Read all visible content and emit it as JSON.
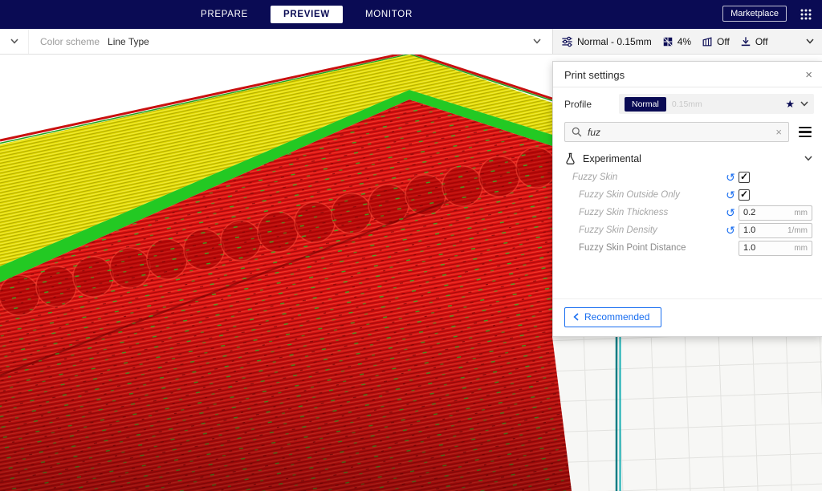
{
  "topbar": {
    "tabs": [
      {
        "label": "PREPARE",
        "active": false
      },
      {
        "label": "PREVIEW",
        "active": true
      },
      {
        "label": "MONITOR",
        "active": false
      }
    ],
    "marketplace_label": "Marketplace"
  },
  "stage_toolbar": {
    "color_scheme_label": "Color scheme",
    "color_scheme_value": "Line Type",
    "printer_config": {
      "profile": "Normal - 0.15mm",
      "infill_percent": "4%",
      "support": "Off",
      "adhesion": "Off"
    }
  },
  "print_settings": {
    "title": "Print settings",
    "close_glyph": "×",
    "profile_label": "Profile",
    "profile_name": "Normal",
    "profile_detail": "0.15mm",
    "star_glyph": "★",
    "search_value": "fuz",
    "clear_glyph": "×",
    "reset_glyph": "↺",
    "section_label": "Experimental",
    "settings": [
      {
        "label": "Fuzzy Skin",
        "type": "checkbox",
        "checked": true,
        "reset": true
      },
      {
        "label": "Fuzzy Skin Outside Only",
        "type": "checkbox",
        "checked": true,
        "reset": true
      },
      {
        "label": "Fuzzy Skin Thickness",
        "type": "number",
        "value": "0.2",
        "unit": "mm",
        "reset": true
      },
      {
        "label": "Fuzzy Skin Density",
        "type": "number",
        "value": "1.0",
        "unit": "1/mm",
        "reset": true
      },
      {
        "label": "Fuzzy Skin Point Distance",
        "type": "number",
        "value": "1.0",
        "unit": "mm",
        "reset": false
      }
    ],
    "recommended_label": "Recommended"
  },
  "viewport": {
    "scheme_colors": {
      "top_skin_yellow": "#e6de00",
      "wall_green": "#23c923",
      "wall_red": "#dd1111",
      "build_volume_edge_teal": "#0a7d84"
    }
  },
  "colors": {
    "accent_blue": "#196ef0",
    "header_navy": "#0a0b54"
  }
}
